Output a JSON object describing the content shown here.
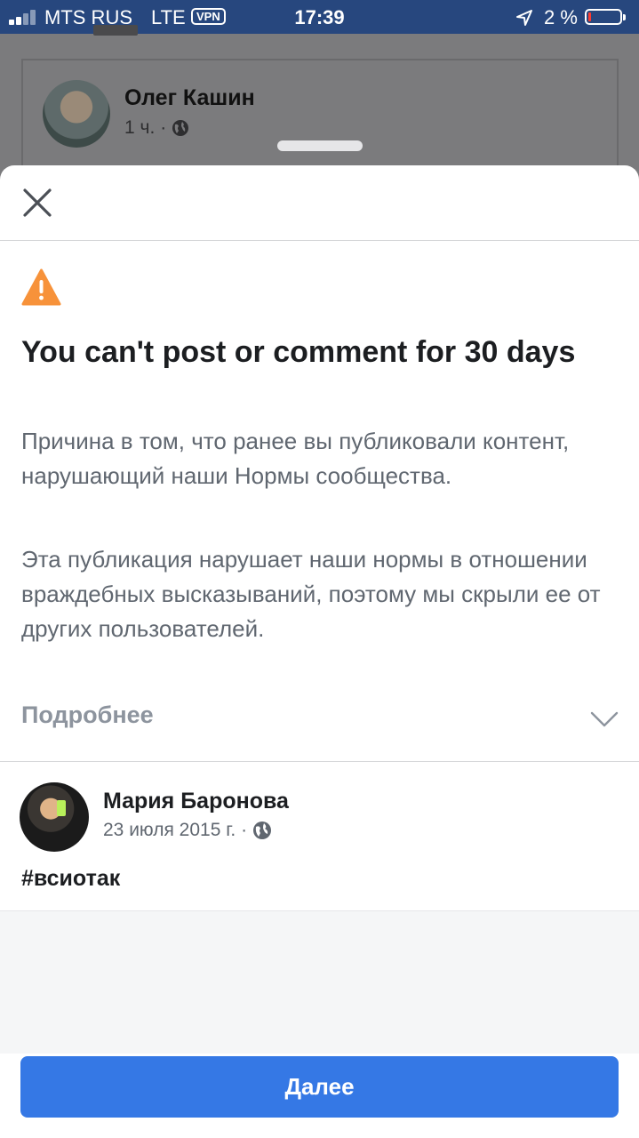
{
  "status_bar": {
    "carrier": "MTS RUS",
    "network": "LTE",
    "vpn": "VPN",
    "time": "17:39",
    "battery_text": "2 %",
    "battery_level_percent": 2
  },
  "background_post": {
    "author": "Олег Кашин",
    "time": "1 ч.",
    "separator": "·"
  },
  "sheet": {
    "title": "You can't post or comment for 30 days",
    "paragraph_1": "Причина в том, что ранее вы публиковали контент, нарушающий наши Нормы сообщества.",
    "paragraph_2": "Эта публикация нарушает наши нормы в отношении враждебных высказываний, поэтому мы скрыли ее от других пользователей.",
    "more_label": "Подробнее",
    "post": {
      "author": "Мария Баронова",
      "date": "23 июля 2015 г.",
      "separator": "·",
      "text": "#всиотак"
    },
    "next_label": "Далее"
  },
  "colors": {
    "status_bar_bg": "#27477e",
    "warning": "#f7923a",
    "primary_button": "#3578e5",
    "battery_low": "#ff3b30"
  },
  "icons": {
    "close": "close-icon",
    "warning": "warning-triangle-icon",
    "chevron": "chevron-down-icon",
    "privacy": "globe-icon",
    "location": "location-arrow-icon"
  }
}
